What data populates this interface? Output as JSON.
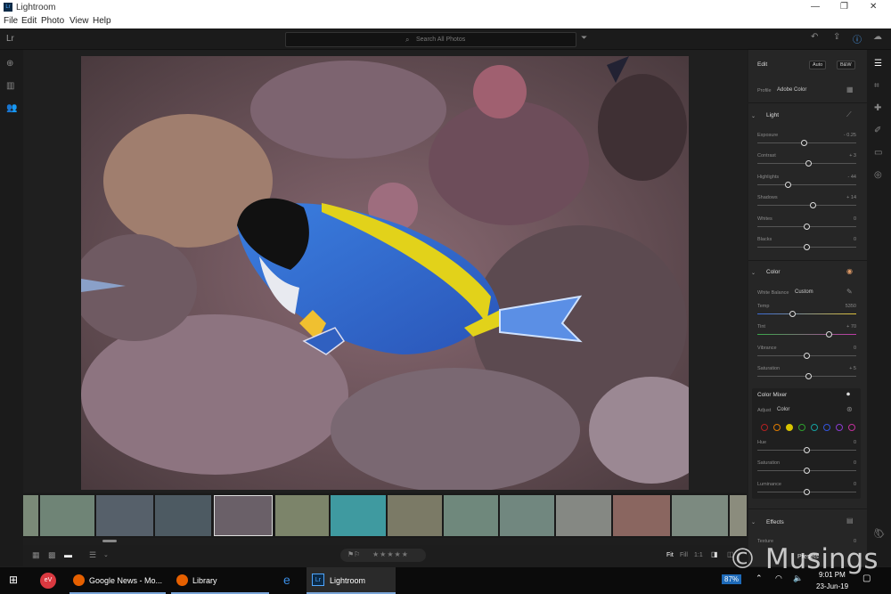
{
  "window": {
    "title": "Lightroom",
    "controls": [
      "—",
      "❐",
      "✕"
    ]
  },
  "menu": [
    "File",
    "Edit",
    "Photo",
    "View",
    "Help"
  ],
  "appbar": {
    "logo": "Lr",
    "search_placeholder": "Search All Photos"
  },
  "panel": {
    "edit_title": "Edit",
    "auto_label": "Auto",
    "bw_label": "B&W",
    "profile_label": "Profile",
    "profile_value": "Adobe Color",
    "light": {
      "title": "Light",
      "sliders": [
        {
          "label": "Exposure",
          "value": "- 0.25",
          "pos": 0.47
        },
        {
          "label": "Contrast",
          "value": "+ 3",
          "pos": 0.52
        },
        {
          "label": "Highlights",
          "value": "- 44",
          "pos": 0.3
        },
        {
          "label": "Shadows",
          "value": "+ 14",
          "pos": 0.57
        },
        {
          "label": "Whites",
          "value": "0",
          "pos": 0.5
        },
        {
          "label": "Blacks",
          "value": "0",
          "pos": 0.5
        }
      ]
    },
    "color": {
      "title": "Color",
      "wb_label": "White Balance",
      "wb_value": "Custom",
      "sliders": [
        {
          "label": "Temp",
          "value": "5350",
          "pos": 0.35
        },
        {
          "label": "Tint",
          "value": "+ 70",
          "pos": 0.74
        },
        {
          "label": "Vibrance",
          "value": "0",
          "pos": 0.5
        },
        {
          "label": "Saturation",
          "value": "+ 5",
          "pos": 0.52
        }
      ]
    },
    "mixer": {
      "title": "Color Mixer",
      "adjust_label": "Adjust",
      "adjust_value": "Color",
      "dots": [
        "#b22222",
        "#e07b00",
        "#d8c400",
        "#2e9e2e",
        "#16a0a0",
        "#3355dd",
        "#8a3cd0",
        "#c0309a"
      ],
      "sliders": [
        {
          "label": "Hue",
          "value": "0",
          "pos": 0.5
        },
        {
          "label": "Saturation",
          "value": "0",
          "pos": 0.5
        },
        {
          "label": "Luminance",
          "value": "0",
          "pos": 0.5
        }
      ]
    },
    "effects": {
      "title": "Effects",
      "texture_label": "Texture",
      "texture_value": "0"
    }
  },
  "bottombar": {
    "fit": "Fit",
    "fill": "Fill",
    "one": "1:1",
    "presets": "Presets"
  },
  "taskbar": {
    "apps": [
      {
        "label": "Google News - Mo..."
      },
      {
        "label": "Library"
      },
      {
        "label": "Lightroom"
      }
    ],
    "battery": "87%",
    "time": "9:01 PM",
    "date": "23-Jun-19"
  },
  "watermark": "© Musings"
}
